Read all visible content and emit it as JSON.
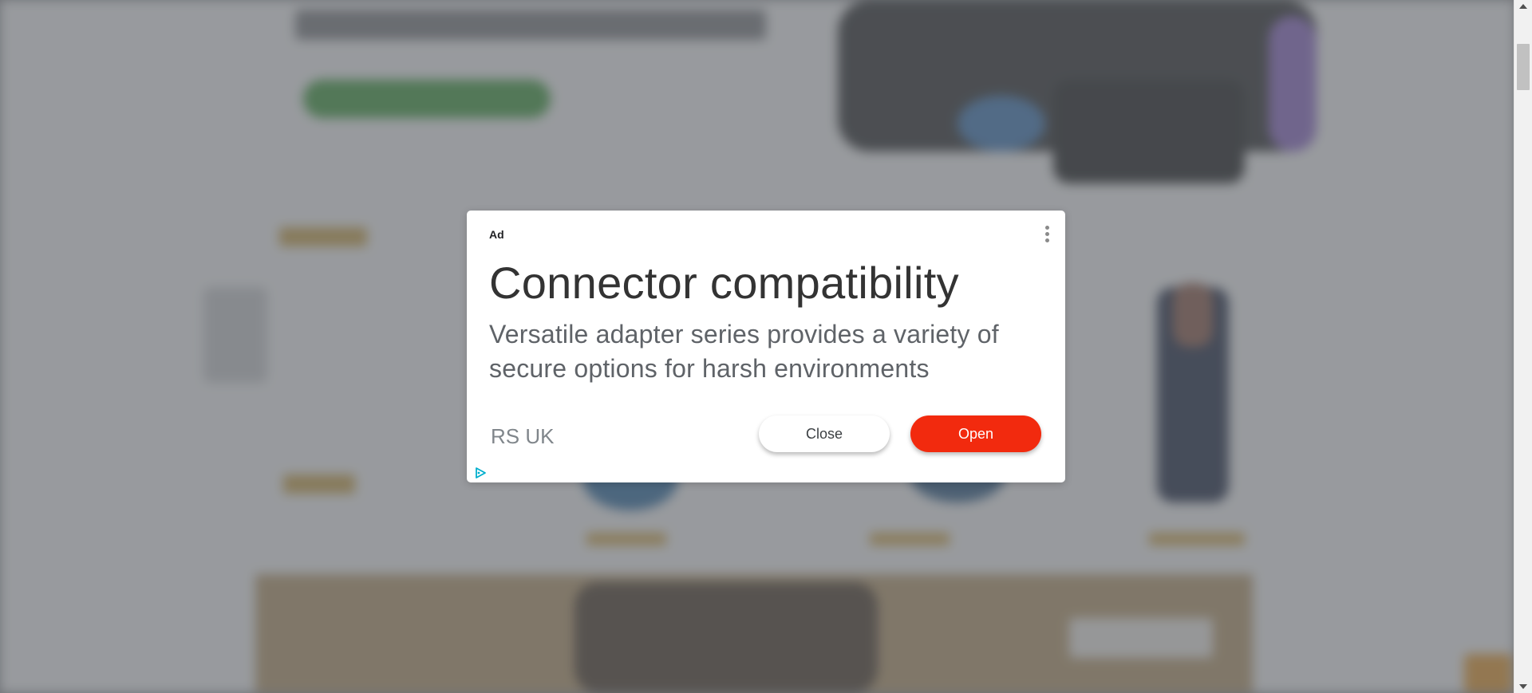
{
  "ad": {
    "badge": "Ad",
    "headline": "Connector compatibility",
    "description": "Versatile adapter series provides a variety of secure options for harsh environments",
    "advertiser": "RS UK",
    "close_label": "Close",
    "open_label": "Open"
  },
  "colors": {
    "open_button": "#f22a0e",
    "overlay": "#5f6368",
    "adchoices": "#00aecd"
  },
  "icons": {
    "menu": "vertical-dots-icon",
    "adchoices": "adchoices-play-icon"
  }
}
